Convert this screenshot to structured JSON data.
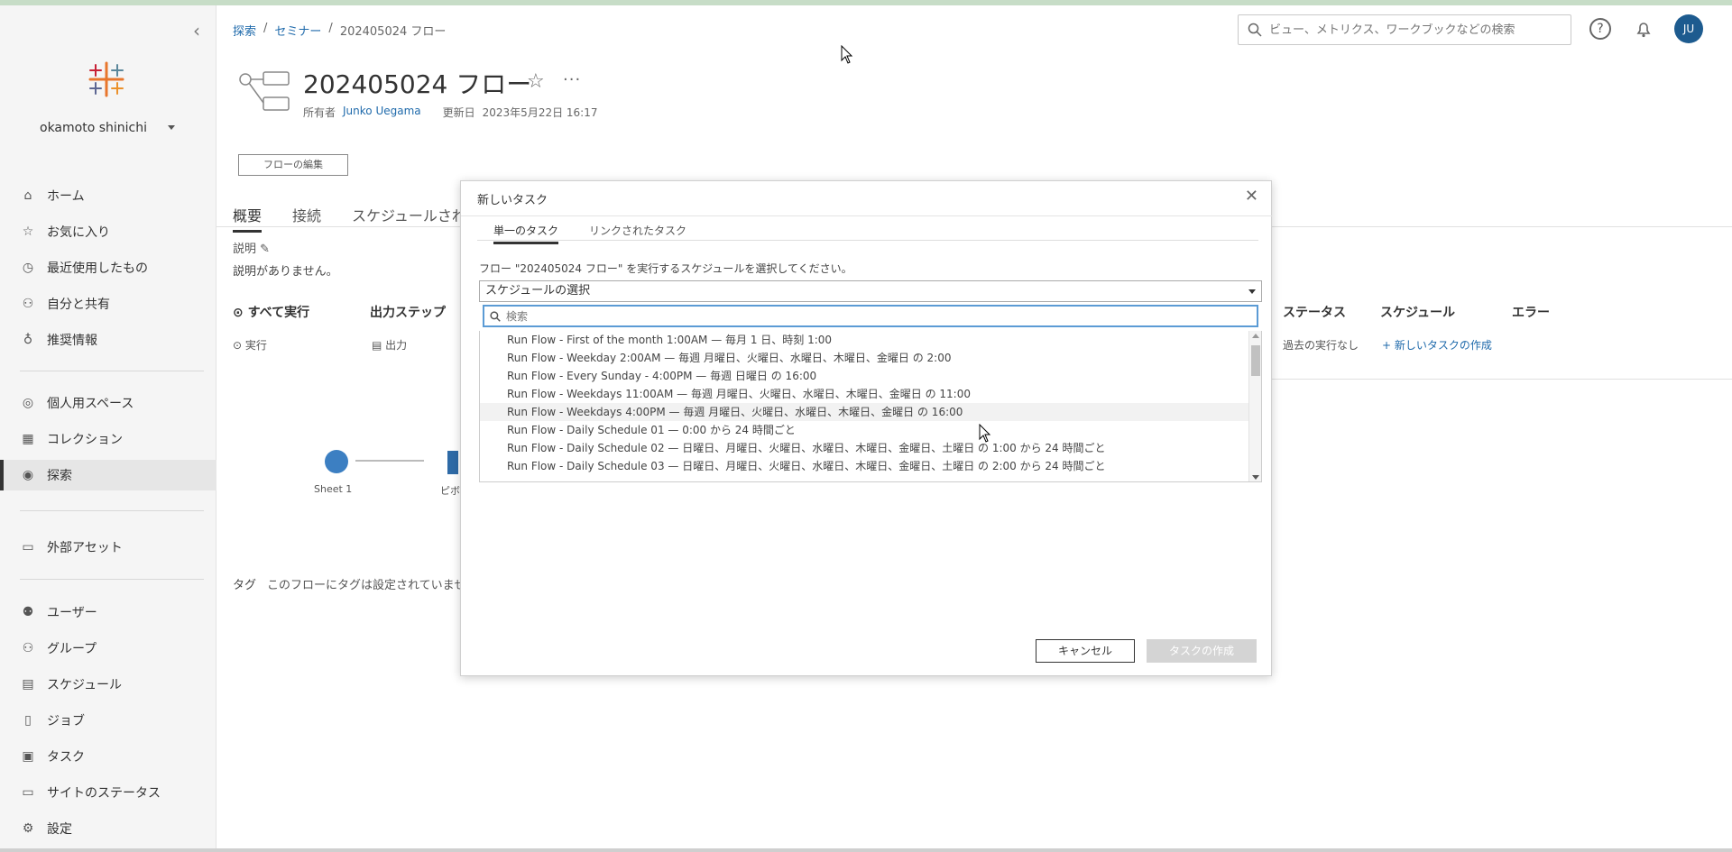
{
  "sidebar": {
    "user_name": "okamoto shinichi",
    "items": [
      {
        "label": "ホーム",
        "icon": "home-icon"
      },
      {
        "label": "お気に入り",
        "icon": "star-icon"
      },
      {
        "label": "最近使用したもの",
        "icon": "clock-icon"
      },
      {
        "label": "自分と共有",
        "icon": "shared-icon"
      },
      {
        "label": "推奨情報",
        "icon": "bulb-icon"
      },
      {
        "label": "個人用スペース",
        "icon": "person-icon"
      },
      {
        "label": "コレクション",
        "icon": "collection-icon"
      },
      {
        "label": "探索",
        "icon": "explore-icon"
      },
      {
        "label": "外部アセット",
        "icon": "external-assets-icon"
      },
      {
        "label": "ユーザー",
        "icon": "users-icon"
      },
      {
        "label": "グループ",
        "icon": "groups-icon"
      },
      {
        "label": "スケジュール",
        "icon": "calendar-icon"
      },
      {
        "label": "ジョブ",
        "icon": "jobs-icon"
      },
      {
        "label": "タスク",
        "icon": "tasks-icon"
      },
      {
        "label": "サイトのステータス",
        "icon": "site-status-icon"
      },
      {
        "label": "設定",
        "icon": "gear-icon"
      }
    ]
  },
  "breadcrumb": [
    "探索",
    "セミナー",
    "202405024 フロー"
  ],
  "search": {
    "placeholder": "ビュー、メトリクス、ワークブックなどの検索"
  },
  "avatar_initials": "JU",
  "header": {
    "title": "202405024 フロー",
    "owner_label": "所有者",
    "owner": "Junko Uegama",
    "updated_label": "更新日",
    "updated": "2023年5月22日 16:17",
    "edit_button": "フローの編集"
  },
  "tabs": [
    "概要",
    "接続",
    "スケジュールされ"
  ],
  "description": {
    "label": "説明",
    "text": "説明がありません。"
  },
  "table": {
    "headers": {
      "run_all": "すべて実行",
      "output_step": "出力ステップ",
      "status": "ステータス",
      "schedule": "スケジュール",
      "error": "エラー"
    },
    "row": {
      "run": "実行",
      "output": "出力",
      "status": "過去の実行なし",
      "schedule": "+ 新しいタスクの作成"
    }
  },
  "flow_nodes": {
    "left": "Sheet 1",
    "right": "ピボ"
  },
  "tags": {
    "label": "タグ",
    "text": "このフローにタグは設定されていません"
  },
  "modal": {
    "title": "新しいタスク",
    "tabs": [
      "単一のタスク",
      "リンクされたタスク"
    ],
    "prompt": "フロー \"202405024 フロー\" を実行するスケジュールを選択してください。",
    "select_placeholder": "スケジュールの選択",
    "search_placeholder": "検索",
    "options": [
      "Run Flow - First of the month 1:00AM — 毎月 1 日、時刻 1:00",
      "Run Flow - Weekday 2:00AM — 毎週 月曜日、火曜日、水曜日、木曜日、金曜日 の 2:00",
      "Run Flow - Every Sunday - 4:00PM — 毎週 日曜日 の 16:00",
      "Run Flow - Weekdays 11:00AM — 毎週 月曜日、火曜日、水曜日、木曜日、金曜日 の 11:00",
      "Run Flow - Weekdays 4:00PM — 毎週 月曜日、火曜日、水曜日、木曜日、金曜日 の 16:00",
      "Run Flow - Daily Schedule 01 — 0:00 から 24 時間ごと",
      "Run Flow - Daily Schedule 02 — 日曜日、月曜日、火曜日、水曜日、木曜日、金曜日、土曜日 の 1:00 から 24 時間ごと",
      "Run Flow - Daily Schedule 03 — 日曜日、月曜日、火曜日、水曜日、木曜日、金曜日、土曜日 の 2:00 から 24 時間ごと"
    ],
    "cancel": "キャンセル",
    "create": "タスクの作成"
  },
  "colors": {
    "accent": "#1f6aab",
    "avatar": "#1d5b8f",
    "node": "#3c7fc2"
  }
}
